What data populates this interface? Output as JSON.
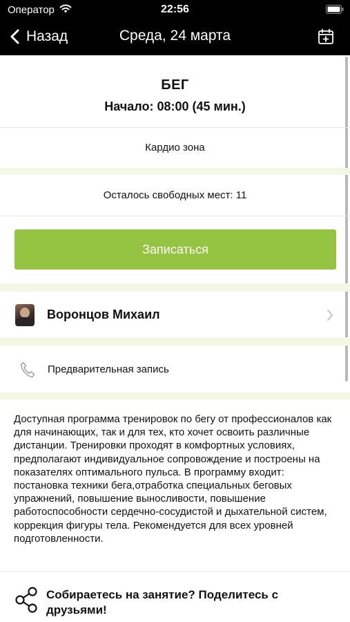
{
  "status_bar": {
    "carrier": "Оператор",
    "time": "22:56"
  },
  "nav": {
    "back_label": "Назад",
    "title": "Среда, 24 марта"
  },
  "class": {
    "name": "БЕГ",
    "start": "Начало: 08:00 (45 мин.)",
    "zone": "Кардио зона",
    "places_left": "Осталось свободных мест: 11"
  },
  "actions": {
    "signup_label": "Записаться"
  },
  "trainer": {
    "name": "Воронцов Михаил"
  },
  "booking": {
    "label": "Предварительная запись"
  },
  "description": "Доступная программа тренировок по бегу от профессионалов как для начинающих, так и для тех, кто хочет освоить различные дистанции. Тренировки проходят в комфортных условиях, предполагают индивидуальное сопровождение и построены на показателях оптимального пульса. В программу входит: постановка техники бега,отработка специальных беговых упражнений, повышение выносливости, повышение работоспособности сердечно-сосудистой и дыхательной систем, коррекция фигуры тела. Рекомендуется для всех уровней подготовленности.",
  "share": {
    "text": "Собираетесь на занятие? Поделитесь с друзьями!"
  },
  "colors": {
    "header_bg": "#000000",
    "accent": "#94c442",
    "band": "#f2f8e3"
  },
  "icons": [
    "wifi-icon",
    "battery-icon",
    "back-chevron-icon",
    "calendar-add-icon",
    "chevron-right-icon",
    "phone-icon",
    "share-icon"
  ]
}
